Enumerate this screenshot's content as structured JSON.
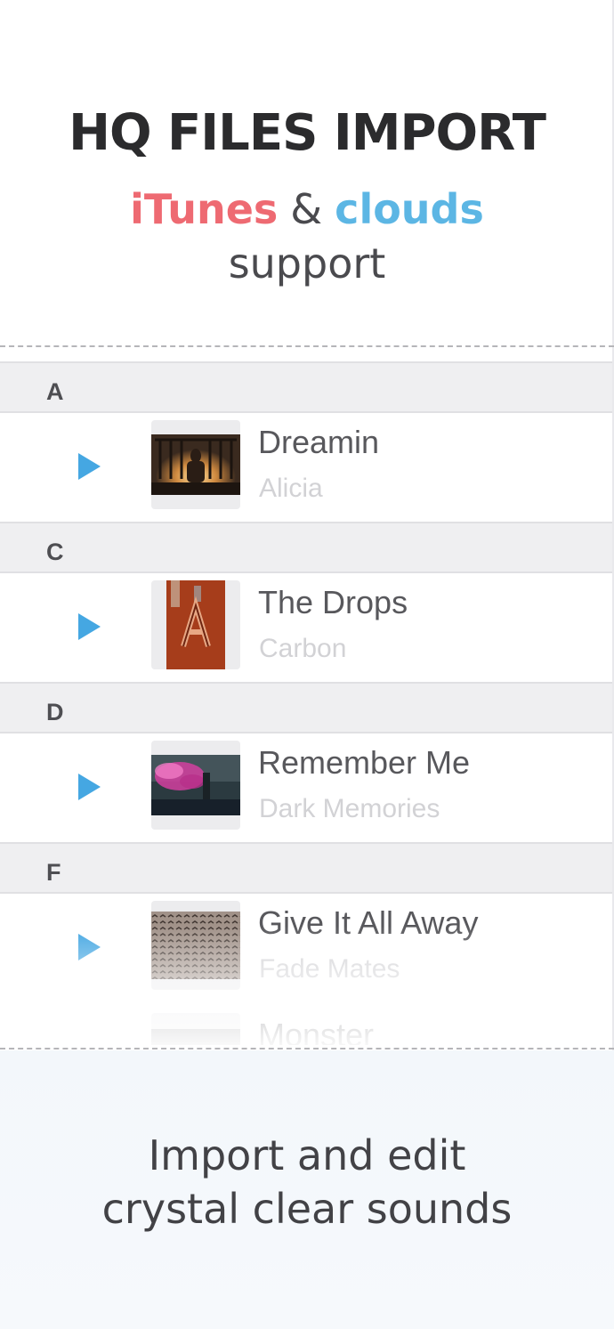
{
  "hero": {
    "title": "HQ FILES IMPORT",
    "itunes": "iTunes",
    "ampersand": "&",
    "clouds": "clouds",
    "support": "support"
  },
  "colors": {
    "itunes": "#ee6a72",
    "clouds": "#5cb6e4",
    "play": "#45a7e2"
  },
  "list": {
    "sections": [
      {
        "letter": "A",
        "tracks": [
          {
            "title": "Dreamin",
            "artist": "Alicia",
            "artwork": "window-silhouette-photo"
          }
        ]
      },
      {
        "letter": "C",
        "tracks": [
          {
            "title": "The Drops",
            "artist": "Carbon",
            "artwork": "rusty-letter-a-photo"
          }
        ]
      },
      {
        "letter": "D",
        "tracks": [
          {
            "title": "Remember Me",
            "artist": "Dark Memories",
            "artwork": "pink-smoke-photo"
          }
        ]
      },
      {
        "letter": "F",
        "tracks": [
          {
            "title": "Give It All Away",
            "artist": "Fade Mates",
            "artwork": "birds-flock-photo"
          },
          {
            "title": "Monster",
            "artist": "",
            "artwork": "grey-photo"
          }
        ]
      }
    ]
  },
  "footer": {
    "line1": "Import and edit",
    "line2": "crystal clear sounds"
  }
}
